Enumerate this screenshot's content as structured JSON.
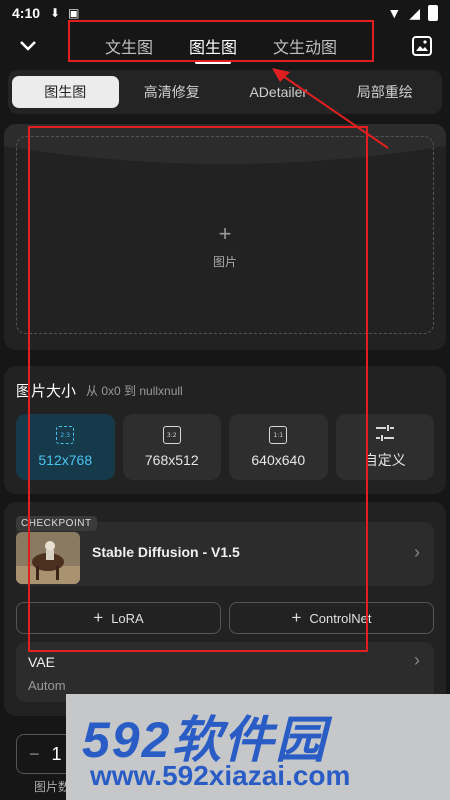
{
  "status": {
    "time": "4:10"
  },
  "header": {
    "tabs": [
      {
        "label": "文生图",
        "active": false
      },
      {
        "label": "图生图",
        "active": true
      },
      {
        "label": "文生动图",
        "active": false
      }
    ]
  },
  "subtabs": [
    "图生图",
    "高清修复",
    "ADetailer",
    "局部重绘"
  ],
  "upload": {
    "label": "图片"
  },
  "size": {
    "title": "图片大小",
    "subtitle": "从 0x0 到 nullxnull",
    "options": [
      {
        "ratio": "2:3",
        "value": "512x768"
      },
      {
        "ratio": "3:2",
        "value": "768x512"
      },
      {
        "ratio": "1:1",
        "value": "640x640"
      },
      {
        "ratio": "",
        "value": "自定义"
      }
    ]
  },
  "model": {
    "badge": "CHECKPOINT",
    "name": "Stable Diffusion - V1.5",
    "lora_label": "LoRA",
    "controlnet_label": "ControlNet",
    "vae_title": "VAE",
    "vae_value": "Autom"
  },
  "batch": {
    "count": "1",
    "label": "图片数"
  },
  "watermark": {
    "brand": "592软件园",
    "url": "www.592xiazai.com"
  },
  "colors": {
    "accent": "#4cc4f0",
    "annotation": "#e02020",
    "watermark": "#2a5cc6"
  }
}
